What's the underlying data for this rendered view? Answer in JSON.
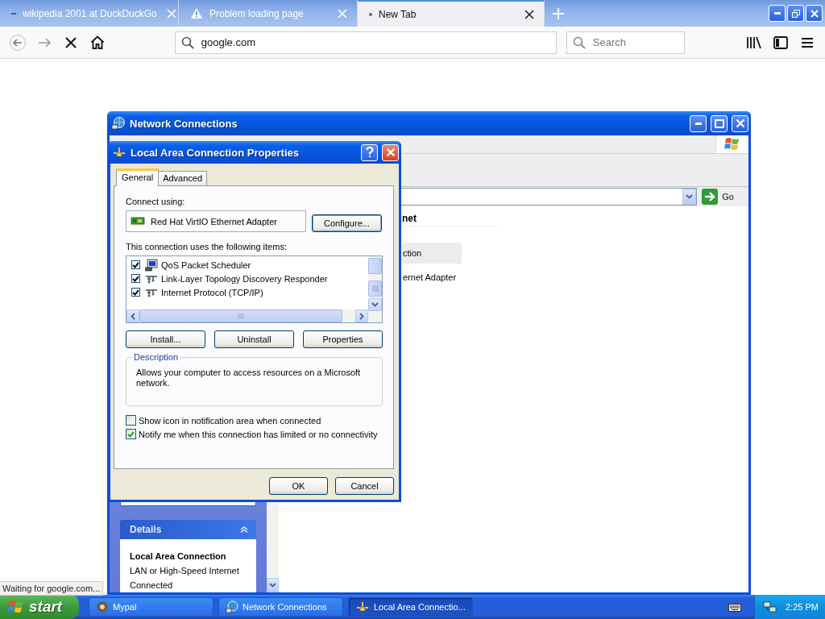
{
  "browser": {
    "tabs": [
      {
        "title": "wikipedia 2001 at DuckDuckGo",
        "kind": "site",
        "selected": false
      },
      {
        "title": "Problem loading page",
        "kind": "warning",
        "selected": false
      },
      {
        "title": "New Tab",
        "kind": "blank",
        "selected": true
      }
    ],
    "url": "google.com",
    "search_placeholder": "Search",
    "status": "Waiting for google.com..."
  },
  "network_window": {
    "title": "Network Connections",
    "go": "Go",
    "column_header": "net",
    "item_lines": [
      {
        "text": "ction",
        "selected": true
      },
      {
        "text": "ernet Adapter",
        "selected": false
      }
    ],
    "details": {
      "title": "Details",
      "expanded": true,
      "name": "Local Area Connection",
      "type": "LAN or High-Speed Internet",
      "status": "Connected"
    }
  },
  "dialog": {
    "title": "Local Area Connection Properties",
    "tabs": [
      {
        "label": "General",
        "selected": true
      },
      {
        "label": "Advanced",
        "selected": false
      }
    ],
    "connect_using_label": "Connect using:",
    "adapter": "Red Hat VirtIO Ethernet Adapter",
    "configure": "Configure...",
    "items_label": "This connection uses the following items:",
    "items": [
      {
        "name": "QoS Packet Scheduler",
        "kind": "service",
        "checked": true
      },
      {
        "name": "Link-Layer Topology Discovery Responder",
        "kind": "protocol",
        "checked": true
      },
      {
        "name": "Internet Protocol (TCP/IP)",
        "kind": "protocol",
        "checked": true
      }
    ],
    "item_buttons": [
      "Install...",
      "Uninstall",
      "Properties"
    ],
    "description_label": "Description",
    "description": "Allows your computer to access resources on a Microsoft network.",
    "options": [
      {
        "label": "Show icon in notification area when connected",
        "checked": false
      },
      {
        "label": "Notify me when this connection has limited or no connectivity",
        "checked": true
      }
    ],
    "footer_buttons": [
      "OK",
      "Cancel"
    ]
  },
  "taskbar": {
    "start": "start",
    "items": [
      {
        "label": "Mypal",
        "kind": "browser",
        "selected": false
      },
      {
        "label": "Network Connections",
        "kind": "network",
        "selected": false
      },
      {
        "label": "Local Area Connectio...",
        "kind": "connection",
        "selected": true
      }
    ],
    "clock": "2:25 PM"
  }
}
